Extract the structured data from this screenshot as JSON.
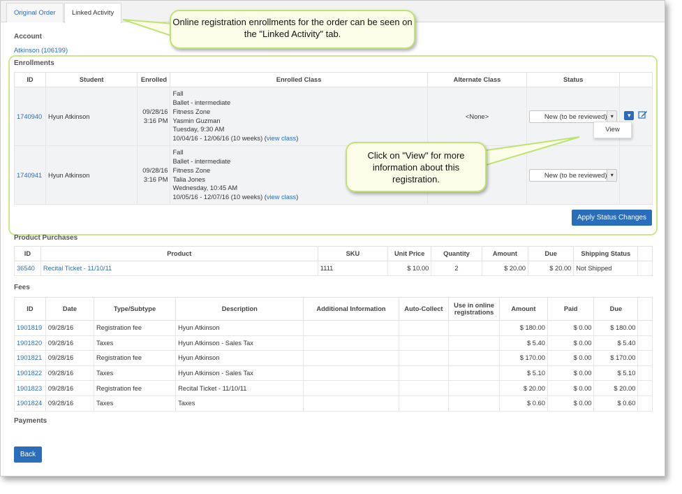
{
  "tabs": [
    "Original Order",
    "Linked Activity"
  ],
  "account": {
    "heading": "Account",
    "name": "Atkinson (106199)"
  },
  "enrollments": {
    "heading": "Enrollments",
    "columns": [
      "ID",
      "Student",
      "Enrolled",
      "Enrolled Class",
      "Alternate Class",
      "Status"
    ],
    "rows": [
      {
        "id": "1740940",
        "student": "Hyun Atkinson",
        "date": "09/28/16",
        "time": "3:16 PM",
        "class_lines": [
          "Fall",
          "Ballet - intermediate",
          "Fitness Zone",
          "Yasmin Guzman",
          "Tuesday, 9:30 AM"
        ],
        "dates": "10/04/16 - 12/06/16 (10 weeks) (",
        "view_class": "view class",
        "close": ")",
        "alternate": "<None>",
        "status": "New (to be reviewed)"
      },
      {
        "id": "1740941",
        "student": "Hyun Atkinson",
        "date": "09/28/16",
        "time": "3:16 PM",
        "class_lines": [
          "Fall",
          "Ballet - intermediate",
          "Fitness Zone",
          "Talia Jones",
          "Wednesday, 10:45 AM"
        ],
        "dates": "10/05/16 - 12/07/16 (10 weeks) (",
        "view_class": "view class",
        "close": ")",
        "alternate": "",
        "status": "New (to be reviewed)"
      }
    ],
    "menu_item": "View",
    "apply_button": "Apply Status Changes"
  },
  "products": {
    "heading": "Product Purchases",
    "columns": [
      "ID",
      "Product",
      "SKU",
      "Unit Price",
      "Quantity",
      "Amount",
      "Due",
      "Shipping Status"
    ],
    "rows": [
      [
        "36540",
        "Recital Ticket - 11/10/11",
        "1111",
        "$ 10.00",
        "2",
        "$ 20.00",
        "$ 20.00",
        "Not Shipped"
      ]
    ]
  },
  "fees": {
    "heading": "Fees",
    "columns": [
      "ID",
      "Date",
      "Type/Subtype",
      "Description",
      "Additional Information",
      "Auto-Collect",
      "Use in online registrations",
      "Amount",
      "Paid",
      "Due"
    ],
    "rows": [
      [
        "1901819",
        "09/28/16",
        "Registration fee",
        "Hyun Atkinson",
        "",
        "",
        "",
        "$ 180.00",
        "$ 0.00",
        "$ 180.00"
      ],
      [
        "1901820",
        "09/28/16",
        "Taxes",
        "Hyun Atkinson - Sales Tax",
        "",
        "",
        "",
        "$ 5.40",
        "$ 0.00",
        "$ 5.40"
      ],
      [
        "1901821",
        "09/28/16",
        "Registration fee",
        "Hyun Atkinson",
        "",
        "",
        "",
        "$ 170.00",
        "$ 0.00",
        "$ 170.00"
      ],
      [
        "1901822",
        "09/28/16",
        "Taxes",
        "Hyun Atkinson - Sales Tax",
        "",
        "",
        "",
        "$ 5.10",
        "$ 0.00",
        "$ 5.10"
      ],
      [
        "1901823",
        "09/28/16",
        "Registration fee",
        "Recital Ticket - 11/10/11",
        "",
        "",
        "",
        "$ 20.00",
        "$ 0.00",
        "$ 20.00"
      ],
      [
        "1901824",
        "09/28/16",
        "Taxes",
        "Taxes",
        "",
        "",
        "",
        "$ 0.60",
        "$ 0.00",
        "$ 0.60"
      ]
    ]
  },
  "payments": {
    "heading": "Payments"
  },
  "back_button": "Back",
  "callouts": {
    "top": "Online registration enrollments for the order can be seen on the \"Linked Activity\" tab.",
    "view": "Click on \"View\" for more information about this registration."
  },
  "colors": {
    "accent": "#2a6ebb",
    "callout_border": "#bfe373",
    "callout_bg": "#fbfde8"
  }
}
